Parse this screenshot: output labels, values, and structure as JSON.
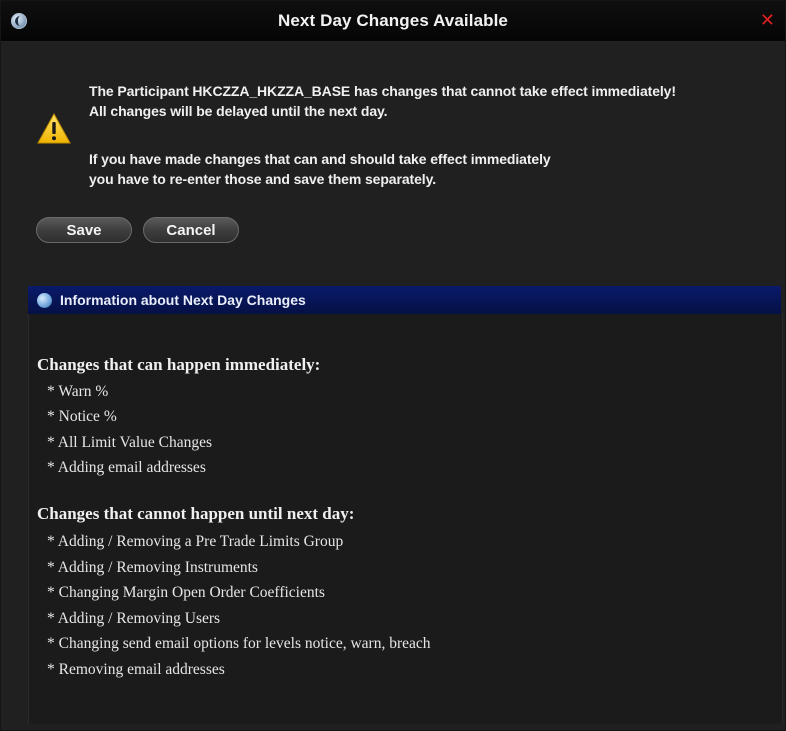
{
  "window": {
    "title": "Next Day Changes Available",
    "close_symbol": "✕",
    "icons": {
      "app": "app-logo-icon",
      "close": "close-icon",
      "warning": "warning-icon",
      "info": "info-icon"
    }
  },
  "message": {
    "line1": "The Participant HKCZZA_HKZZA_BASE has changes that cannot take effect immediately!",
    "line2": "All changes will be delayed until the next day.",
    "line3": "If you have made changes that can and should take effect immediately",
    "line4": "you have to re-enter those and save them separately."
  },
  "buttons": {
    "save_label": "Save",
    "cancel_label": "Cancel"
  },
  "info": {
    "header_title": "Information about Next Day Changes",
    "immediate": {
      "heading": "Changes that can happen immediately:",
      "items": [
        "* Warn %",
        "* Notice %",
        "* All Limit Value Changes",
        "* Adding email addresses"
      ]
    },
    "next_day": {
      "heading": "Changes that cannot happen until next day:",
      "items": [
        "* Adding / Removing a Pre Trade Limits Group",
        "* Adding / Removing Instruments",
        "* Changing Margin Open Order Coefficients",
        "* Adding / Removing Users",
        "* Changing send email options for levels notice, warn, breach",
        "* Removing email addresses"
      ]
    }
  },
  "colors": {
    "title_bar": "#050505",
    "close": "#e02020",
    "info_header": "#0a1a6a",
    "warning": "#f5c400"
  }
}
